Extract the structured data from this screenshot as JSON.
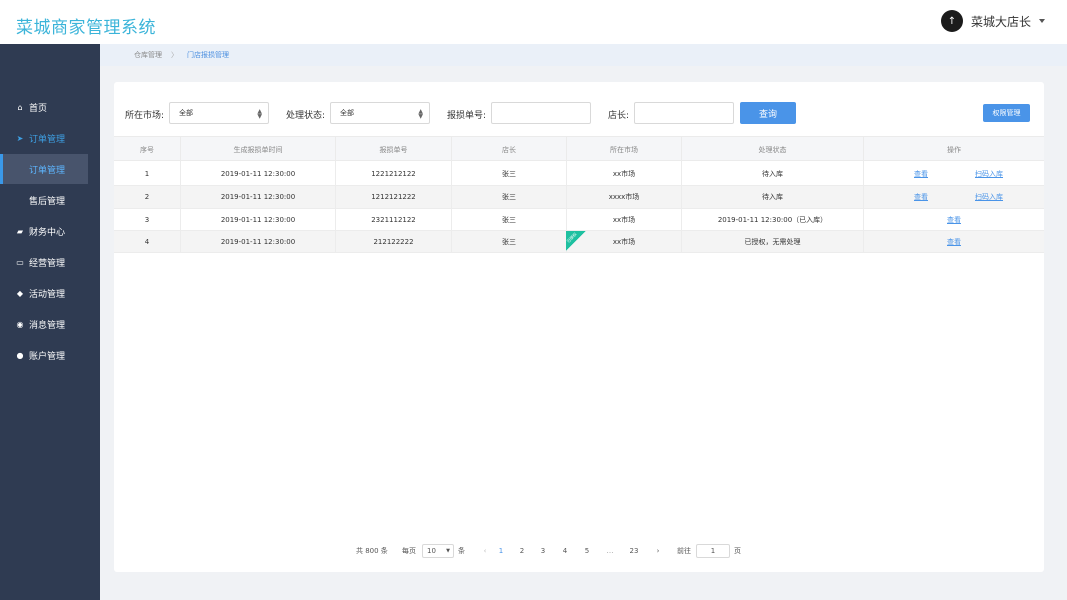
{
  "app": {
    "title": "菜城商家管理系统",
    "user_name": "菜城大店长",
    "avatar_glyph": "↑"
  },
  "sidebar": {
    "items": [
      {
        "label": "首页",
        "icon": "home-icon",
        "glyph": "⌂"
      },
      {
        "label": "订单管理",
        "icon": "send-icon",
        "glyph": "➤"
      },
      {
        "label": "订单管理",
        "icon": "",
        "glyph": ""
      },
      {
        "label": "售后管理",
        "icon": "",
        "glyph": ""
      },
      {
        "label": "财务中心",
        "icon": "wallet-icon",
        "glyph": "▰"
      },
      {
        "label": "经营管理",
        "icon": "monitor-icon",
        "glyph": "▭"
      },
      {
        "label": "活动管理",
        "icon": "cube-icon",
        "glyph": "◆"
      },
      {
        "label": "消息管理",
        "icon": "bell-icon",
        "glyph": "◉"
      },
      {
        "label": "账户管理",
        "icon": "user-icon",
        "glyph": "●"
      }
    ]
  },
  "breadcrumb": {
    "parent": "仓库管理",
    "separator": "〉",
    "current": "门店报损管理"
  },
  "filters": {
    "market_label": "所在市场:",
    "market_value": "全部",
    "status_label": "处理状态:",
    "status_value": "全部",
    "report_no_label": "报损单号:",
    "report_no_value": "",
    "manager_label": "店长:",
    "manager_value": "",
    "query_button": "查询",
    "permission_button": "权限管理"
  },
  "table": {
    "headers": [
      "序号",
      "生成报损单时间",
      "报损单号",
      "店长",
      "所在市场",
      "处理状态",
      "操作"
    ],
    "rows": [
      {
        "index": "1",
        "time": "2019-01-11  12:30:00",
        "report_no": "1221212122",
        "manager": "张三",
        "market": "xx市场",
        "status": "待入库",
        "actions": [
          "查看",
          "扫码入库"
        ]
      },
      {
        "index": "2",
        "time": "2019-01-11  12:30:00",
        "report_no": "1212121222",
        "manager": "张三",
        "market": "xxxx市场",
        "status": "待入库",
        "actions": [
          "查看",
          "扫码入库"
        ]
      },
      {
        "index": "3",
        "time": "2019-01-11  12:30:00",
        "report_no": "2321112122",
        "manager": "张三",
        "market": "xx市场",
        "status": "2019-01-11  12:30:00（已入库）",
        "actions": [
          "查看"
        ]
      },
      {
        "index": "4",
        "time": "2019-01-11  12:30:00",
        "report_no": "212122222",
        "manager": "张三",
        "market": "xx市场",
        "status": "已授权，无需处理",
        "actions": [
          "查看"
        ]
      }
    ],
    "ribbon_text": "已授权"
  },
  "pagination": {
    "total": "共 800 条",
    "per_page_label": "每页",
    "per_page_value": "10",
    "per_page_unit": "条",
    "prev": "‹",
    "pages": [
      "1",
      "2",
      "3",
      "4",
      "5",
      "…",
      "23"
    ],
    "current_page": "1",
    "next": "›",
    "goto_label": "前往",
    "goto_value": "1",
    "goto_unit": "页"
  },
  "colors": {
    "brand": "#3bb4d9",
    "sidebar_bg": "#2f3b52",
    "accent": "#4a94e8",
    "ribbon": "#1ec0a0"
  }
}
